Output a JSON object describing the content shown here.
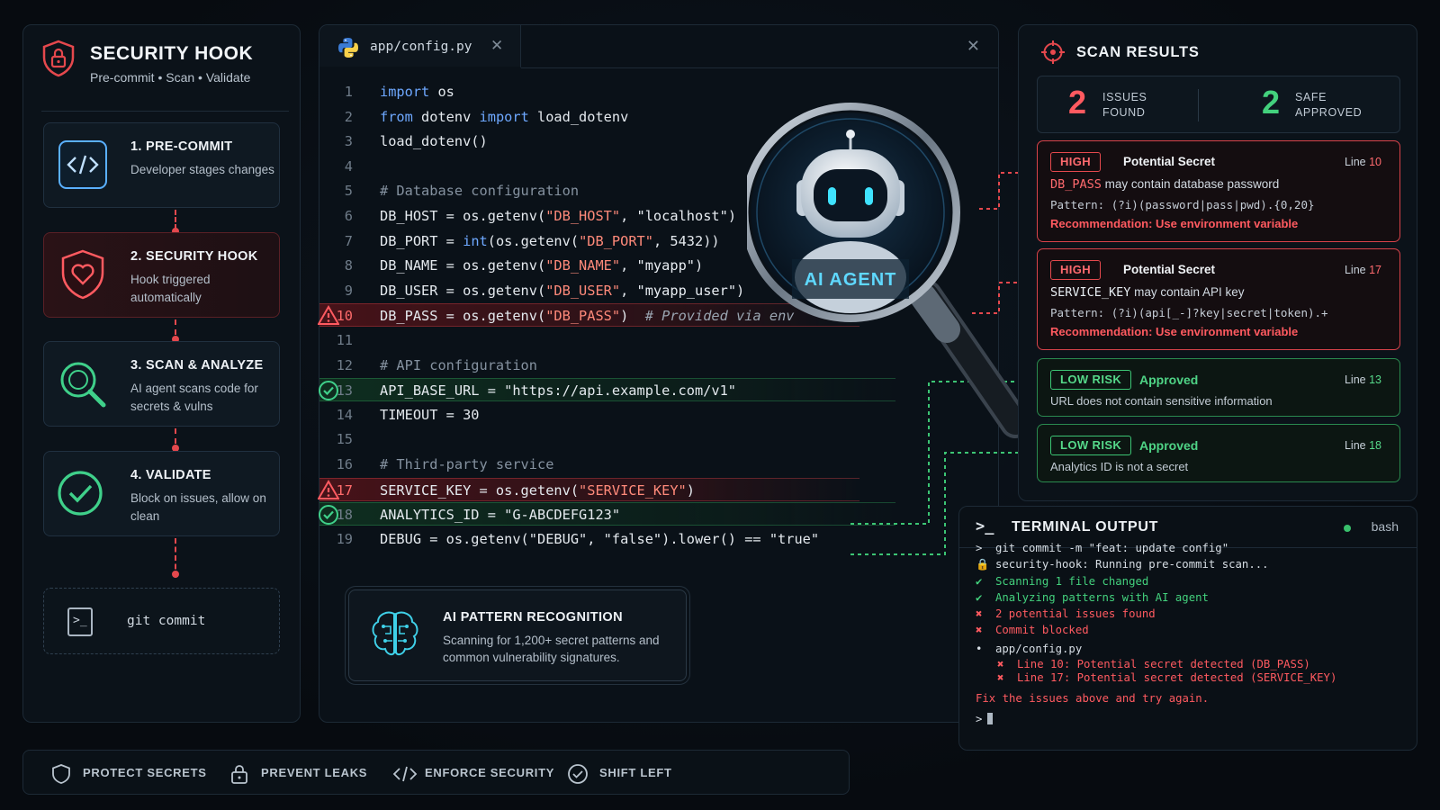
{
  "sidebar": {
    "title": "SECURITY HOOK",
    "subtitle": "Pre-commit • Scan • Validate",
    "steps": [
      {
        "title": "1. PRE-COMMIT",
        "desc": "Developer stages changes"
      },
      {
        "title": "2. SECURITY HOOK",
        "desc": "Hook triggered automatically"
      },
      {
        "title": "3. SCAN & ANALYZE",
        "desc": "AI agent scans code for secrets & vulns"
      },
      {
        "title": "4. VALIDATE",
        "desc": "Block on issues, allow on clean"
      }
    ],
    "git_commit": "git commit"
  },
  "editor": {
    "tab_name": "app/config.py",
    "ai_card": {
      "title": "AI PATTERN RECOGNITION",
      "desc": "Scanning for 1,200+ secret patterns and common vulnerability signatures."
    }
  },
  "magnifier": {
    "label": "AI AGENT"
  },
  "code_lines": [
    {
      "n": "1",
      "parts": [
        [
          "kw",
          "import"
        ],
        [
          "p",
          " os"
        ]
      ]
    },
    {
      "n": "2",
      "parts": [
        [
          "kw",
          "from"
        ],
        [
          "p",
          " dotenv "
        ],
        [
          "kw",
          "import"
        ],
        [
          "p",
          " load_dotenv"
        ]
      ]
    },
    {
      "n": "3",
      "parts": [
        [
          "p",
          "load_dotenv()"
        ]
      ]
    },
    {
      "n": "4",
      "parts": []
    },
    {
      "n": "5",
      "parts": [
        [
          "cm",
          "# Database configuration"
        ]
      ]
    },
    {
      "n": "6",
      "parts": [
        [
          "p",
          "DB_HOST = os.getenv("
        ],
        [
          "str",
          "\"DB_HOST\""
        ],
        [
          "p",
          ", "
        ],
        [
          "str2",
          "\"localhost\""
        ],
        [
          "p",
          ")"
        ]
      ]
    },
    {
      "n": "7",
      "parts": [
        [
          "p",
          "DB_PORT = "
        ],
        [
          "fn",
          "int"
        ],
        [
          "p",
          "(os.getenv("
        ],
        [
          "str",
          "\"DB_PORT\""
        ],
        [
          "p",
          ", 5432))"
        ]
      ]
    },
    {
      "n": "8",
      "parts": [
        [
          "p",
          "DB_NAME = os.getenv("
        ],
        [
          "str",
          "\"DB_NAME\""
        ],
        [
          "p",
          ", "
        ],
        [
          "str2",
          "\"myapp\""
        ],
        [
          "p",
          ")"
        ]
      ]
    },
    {
      "n": "9",
      "parts": [
        [
          "p",
          "DB_USER = os.getenv("
        ],
        [
          "str",
          "\"DB_USER\""
        ],
        [
          "p",
          ", "
        ],
        [
          "str2",
          "\"myapp_user\""
        ],
        [
          "p",
          ")"
        ]
      ]
    },
    {
      "n": "10",
      "state": "bad",
      "parts": [
        [
          "p",
          "DB_PASS = os.getenv("
        ],
        [
          "str",
          "\"DB_PASS\""
        ],
        [
          "p",
          ")  "
        ],
        [
          "cmi",
          "# Provided via env"
        ]
      ]
    },
    {
      "n": "11",
      "parts": []
    },
    {
      "n": "12",
      "parts": [
        [
          "cm",
          "# API configuration"
        ]
      ]
    },
    {
      "n": "13",
      "state": "good",
      "parts": [
        [
          "p",
          "API_BASE_URL = \"https://api.example.com/v1\""
        ]
      ]
    },
    {
      "n": "14",
      "parts": [
        [
          "p",
          "TIMEOUT = 30"
        ]
      ]
    },
    {
      "n": "15",
      "parts": []
    },
    {
      "n": "16",
      "parts": [
        [
          "cm",
          "# Third-party service"
        ]
      ]
    },
    {
      "n": "17",
      "state": "bad",
      "parts": [
        [
          "p",
          "SERVICE_KEY = os.getenv("
        ],
        [
          "str",
          "\"SERVICE_KEY\""
        ],
        [
          "p",
          ")"
        ]
      ]
    },
    {
      "n": "18",
      "state": "good",
      "parts": [
        [
          "p",
          "ANALYTICS_ID = \"G-ABCDEFG123\""
        ]
      ]
    },
    {
      "n": "19",
      "parts": [
        [
          "p",
          "DEBUG = os.getenv(\"DEBUG\", \"false\").lower() == \"true\""
        ]
      ]
    }
  ],
  "results": {
    "title": "SCAN RESULTS",
    "issues_count": "2",
    "issues_label_1": "ISSUES",
    "issues_label_2": "FOUND",
    "safe_count": "2",
    "safe_label_1": "SAFE",
    "safe_label_2": "APPROVED",
    "items": [
      {
        "badge": "HIGH",
        "kind": "Potential Secret",
        "line_label": "Line",
        "line": "10",
        "var": "DB_PASS",
        "msg": "may contain database password",
        "pattern": "Pattern: (?i)(password|pass|pwd).{0,20}",
        "rec": "Recommendation: Use environment variable"
      },
      {
        "badge": "HIGH",
        "kind": "Potential Secret",
        "line_label": "Line",
        "line": "17",
        "var": "SERVICE_KEY",
        "msg": "may contain API key",
        "pattern": "Pattern: (?i)(api[_-]?key|secret|token).+",
        "rec": "Recommendation: Use environment variable"
      },
      {
        "badge": "LOW RISK",
        "kind": "Approved",
        "line_label": "Line",
        "line": "13",
        "msg": "URL does not contain sensitive information"
      },
      {
        "badge": "LOW RISK",
        "kind": "Approved",
        "line_label": "Line",
        "line": "18",
        "msg": "Analytics ID is not a secret"
      }
    ]
  },
  "terminal": {
    "title": "TERMINAL OUTPUT",
    "prompt_icon": ">_",
    "shell": "bash",
    "lines": [
      {
        "g": ">",
        "cls": "plain",
        "text": "git commit -m \"feat: update config\""
      },
      {
        "g": "🔒",
        "cls": "plain",
        "text": "security-hook: Running pre-commit scan..."
      },
      {
        "g": "✔",
        "cls": "ok",
        "text": "Scanning 1 file changed"
      },
      {
        "g": "✔",
        "cls": "ok",
        "text": "Analyzing patterns with AI agent"
      },
      {
        "g": "✖",
        "cls": "err",
        "text": "2 potential issues found"
      },
      {
        "g": "✖",
        "cls": "err",
        "text": "Commit blocked"
      },
      {
        "g": "•",
        "cls": "plain",
        "text": "app/config.py"
      },
      {
        "g": "✖",
        "cls": "err",
        "text": "Line 10: Potential secret detected (DB_PASS)",
        "indent": true
      },
      {
        "g": "✖",
        "cls": "err",
        "text": "Line 17: Potential secret detected (SERVICE_KEY)",
        "indent": true
      },
      {
        "g": "",
        "cls": "err",
        "text": "Fix the issues above and try again."
      }
    ],
    "final_prompt": ">"
  },
  "footer": {
    "items": [
      "PROTECT SECRETS",
      "PREVENT LEAKS",
      "ENFORCE SECURITY",
      "SHIFT LEFT"
    ]
  },
  "colors": {
    "danger": "#e5484d",
    "ok": "#3cc574",
    "accent": "#6ea8ff",
    "cyan": "#3fd0e8"
  }
}
